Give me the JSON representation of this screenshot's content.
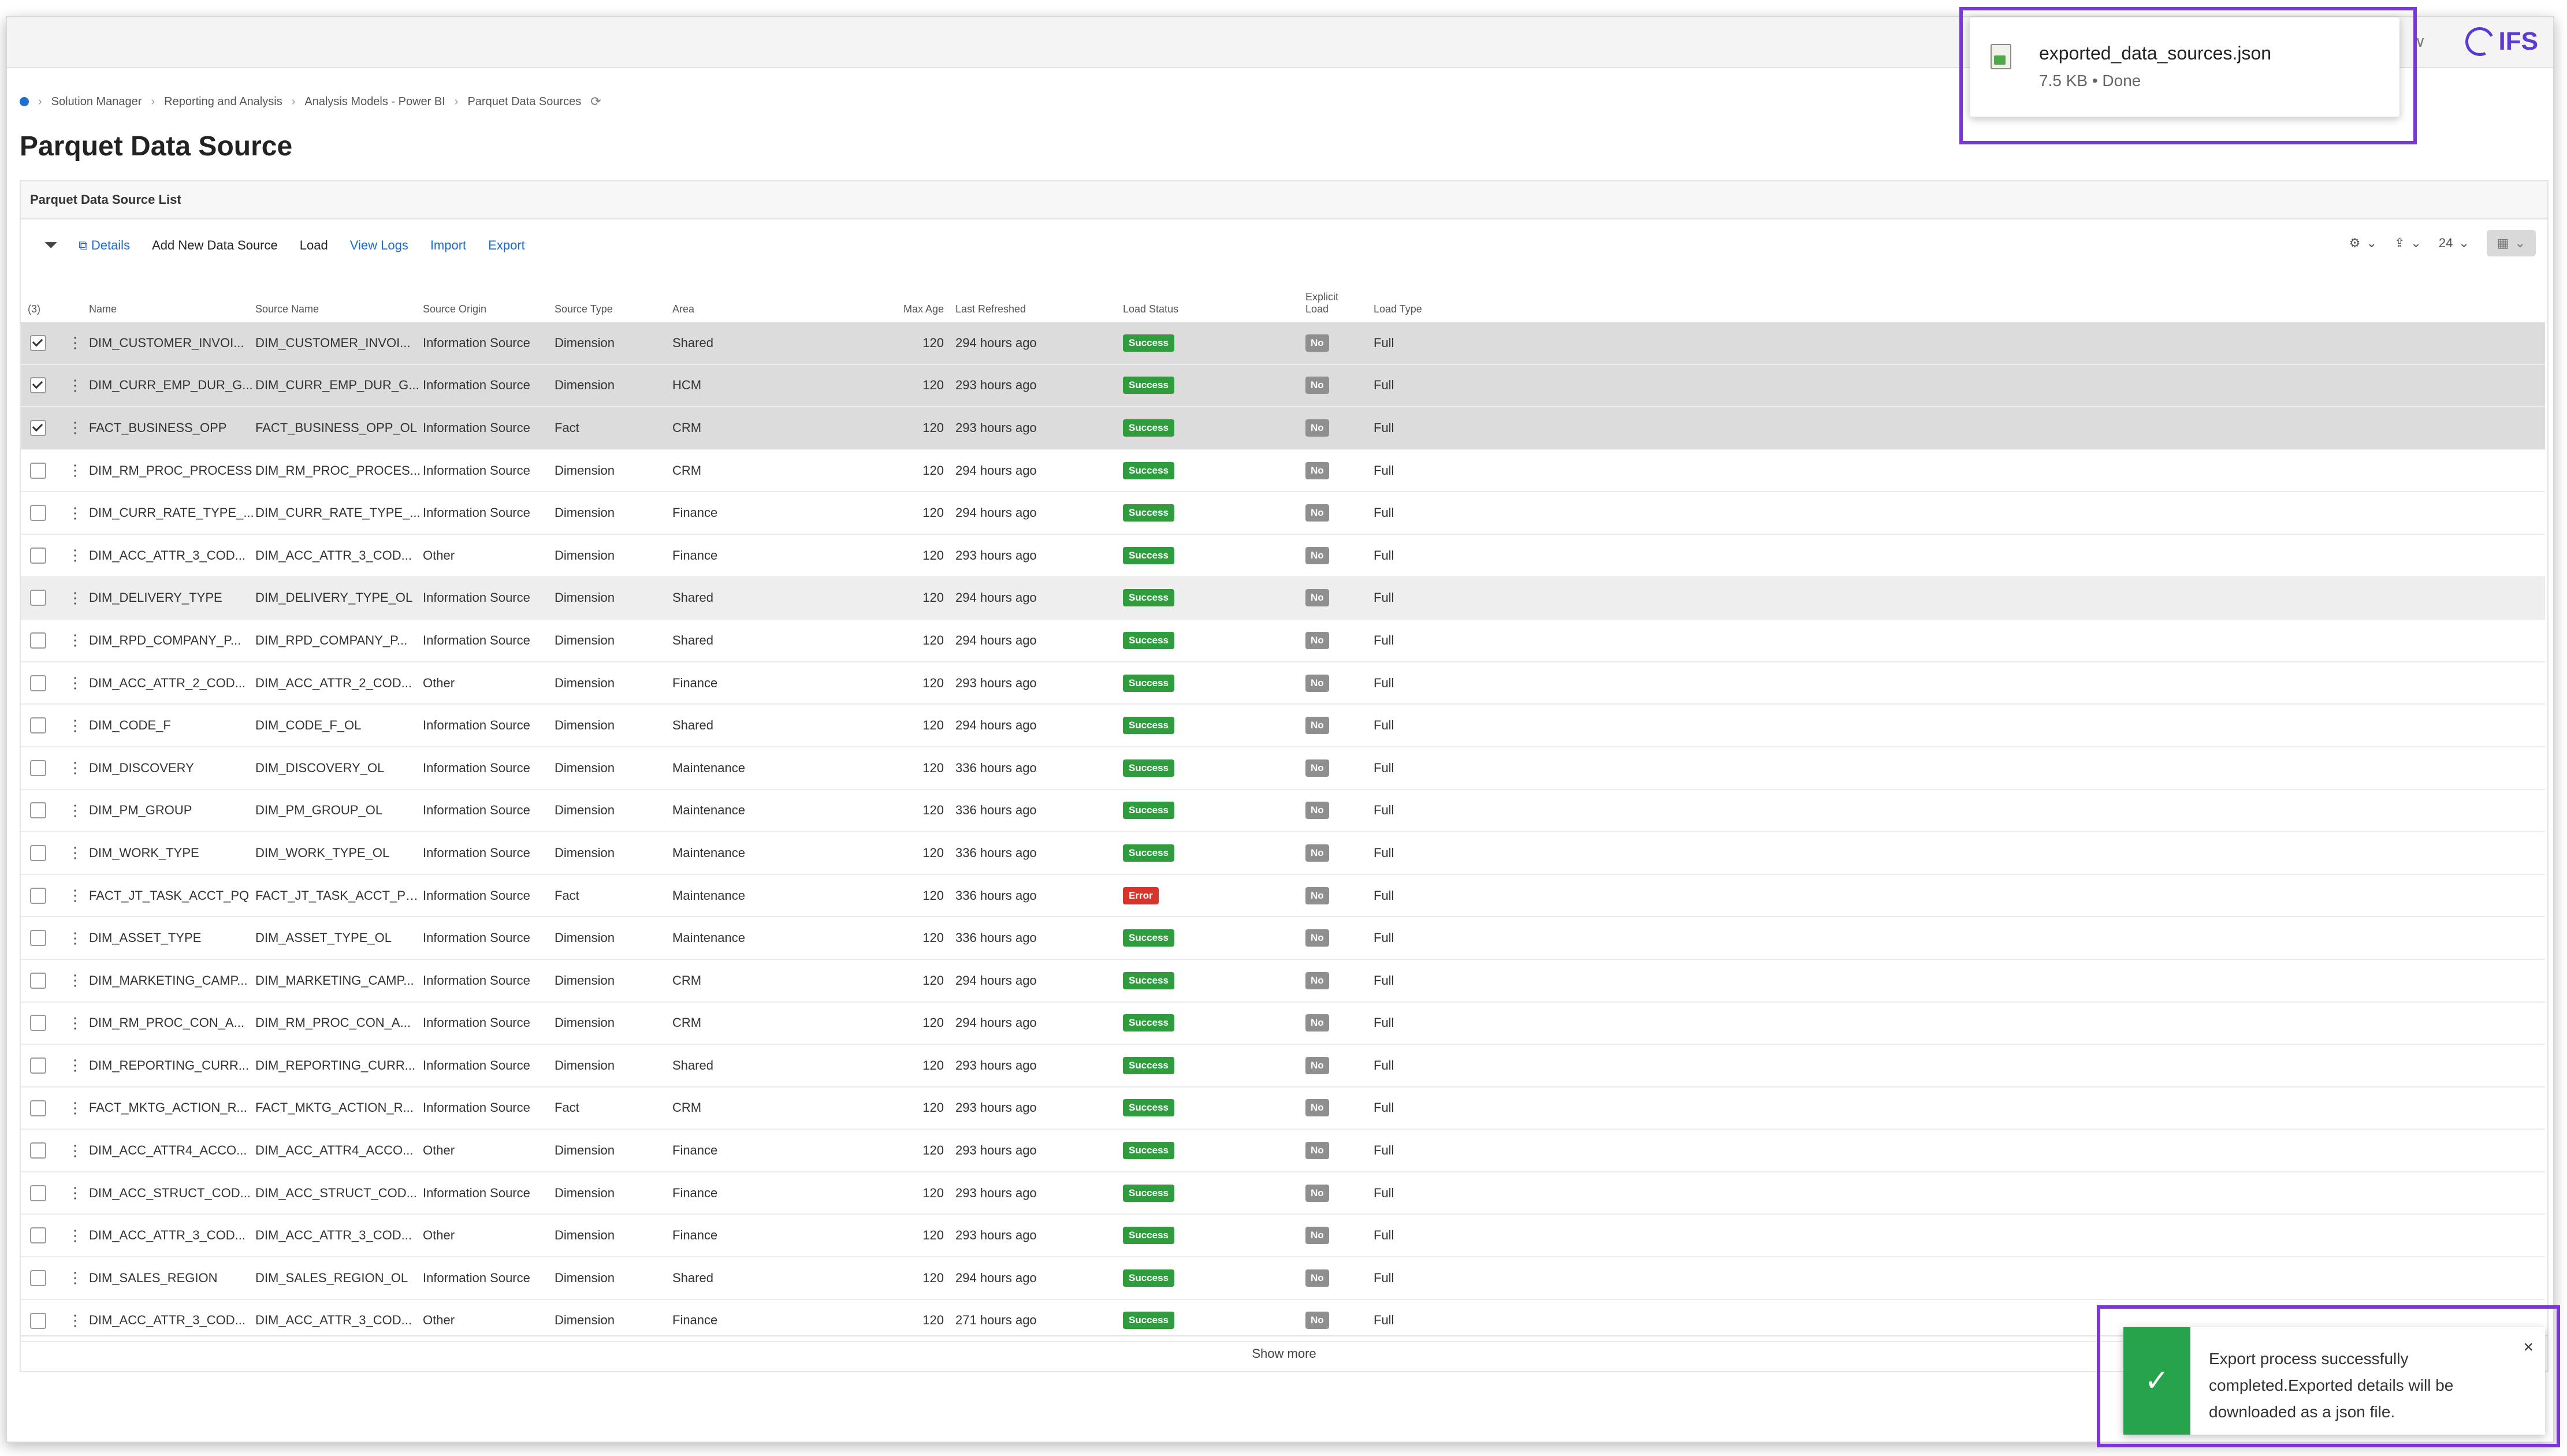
{
  "breadcrumb": [
    "Solution Manager",
    "Reporting and Analysis",
    "Analysis Models - Power BI",
    "Parquet Data Sources"
  ],
  "page_title": "Parquet Data Source",
  "list_title": "Parquet Data Source List",
  "brand": "IFS",
  "toolbar": {
    "details": "Details",
    "add": "Add New Data Source",
    "load": "Load",
    "view_logs": "View Logs",
    "import": "Import",
    "export": "Export",
    "page_size": "24"
  },
  "columns": {
    "selected_count": "(3)",
    "name": "Name",
    "source_name": "Source Name",
    "source_origin": "Source Origin",
    "source_type": "Source Type",
    "area": "Area",
    "max_age": "Max Age",
    "last_refreshed": "Last Refreshed",
    "load_status": "Load Status",
    "explicit_load_1": "Explicit",
    "explicit_load_2": "Load",
    "load_type": "Load Type"
  },
  "rows": [
    {
      "checked": true,
      "name": "DIM_CUSTOMER_INVOI...",
      "source": "DIM_CUSTOMER_INVOI...",
      "origin": "Information Source",
      "type": "Dimension",
      "area": "Shared",
      "max_age": "120",
      "refreshed": "294 hours ago",
      "status": "Success",
      "explicit": "No",
      "load_type": "Full"
    },
    {
      "checked": true,
      "name": "DIM_CURR_EMP_DUR_G...",
      "source": "DIM_CURR_EMP_DUR_G...",
      "origin": "Information Source",
      "type": "Dimension",
      "area": "HCM",
      "max_age": "120",
      "refreshed": "293 hours ago",
      "status": "Success",
      "explicit": "No",
      "load_type": "Full"
    },
    {
      "checked": true,
      "name": "FACT_BUSINESS_OPP",
      "source": "FACT_BUSINESS_OPP_OL",
      "origin": "Information Source",
      "type": "Fact",
      "area": "CRM",
      "max_age": "120",
      "refreshed": "293 hours ago",
      "status": "Success",
      "explicit": "No",
      "load_type": "Full"
    },
    {
      "checked": false,
      "name": "DIM_RM_PROC_PROCESS",
      "source": "DIM_RM_PROC_PROCES...",
      "origin": "Information Source",
      "type": "Dimension",
      "area": "CRM",
      "max_age": "120",
      "refreshed": "294 hours ago",
      "status": "Success",
      "explicit": "No",
      "load_type": "Full"
    },
    {
      "checked": false,
      "name": "DIM_CURR_RATE_TYPE_...",
      "source": "DIM_CURR_RATE_TYPE_...",
      "origin": "Information Source",
      "type": "Dimension",
      "area": "Finance",
      "max_age": "120",
      "refreshed": "294 hours ago",
      "status": "Success",
      "explicit": "No",
      "load_type": "Full"
    },
    {
      "checked": false,
      "name": "DIM_ACC_ATTR_3_COD...",
      "source": "DIM_ACC_ATTR_3_COD...",
      "origin": "Other",
      "type": "Dimension",
      "area": "Finance",
      "max_age": "120",
      "refreshed": "293 hours ago",
      "status": "Success",
      "explicit": "No",
      "load_type": "Full"
    },
    {
      "checked": false,
      "name": "DIM_DELIVERY_TYPE",
      "source": "DIM_DELIVERY_TYPE_OL",
      "origin": "Information Source",
      "type": "Dimension",
      "area": "Shared",
      "max_age": "120",
      "refreshed": "294 hours ago",
      "status": "Success",
      "explicit": "No",
      "load_type": "Full"
    },
    {
      "checked": false,
      "name": "DIM_RPD_COMPANY_P...",
      "source": "DIM_RPD_COMPANY_P...",
      "origin": "Information Source",
      "type": "Dimension",
      "area": "Shared",
      "max_age": "120",
      "refreshed": "294 hours ago",
      "status": "Success",
      "explicit": "No",
      "load_type": "Full"
    },
    {
      "checked": false,
      "name": "DIM_ACC_ATTR_2_COD...",
      "source": "DIM_ACC_ATTR_2_COD...",
      "origin": "Other",
      "type": "Dimension",
      "area": "Finance",
      "max_age": "120",
      "refreshed": "293 hours ago",
      "status": "Success",
      "explicit": "No",
      "load_type": "Full"
    },
    {
      "checked": false,
      "name": "DIM_CODE_F",
      "source": "DIM_CODE_F_OL",
      "origin": "Information Source",
      "type": "Dimension",
      "area": "Shared",
      "max_age": "120",
      "refreshed": "294 hours ago",
      "status": "Success",
      "explicit": "No",
      "load_type": "Full"
    },
    {
      "checked": false,
      "name": "DIM_DISCOVERY",
      "source": "DIM_DISCOVERY_OL",
      "origin": "Information Source",
      "type": "Dimension",
      "area": "Maintenance",
      "max_age": "120",
      "refreshed": "336 hours ago",
      "status": "Success",
      "explicit": "No",
      "load_type": "Full"
    },
    {
      "checked": false,
      "name": "DIM_PM_GROUP",
      "source": "DIM_PM_GROUP_OL",
      "origin": "Information Source",
      "type": "Dimension",
      "area": "Maintenance",
      "max_age": "120",
      "refreshed": "336 hours ago",
      "status": "Success",
      "explicit": "No",
      "load_type": "Full"
    },
    {
      "checked": false,
      "name": "DIM_WORK_TYPE",
      "source": "DIM_WORK_TYPE_OL",
      "origin": "Information Source",
      "type": "Dimension",
      "area": "Maintenance",
      "max_age": "120",
      "refreshed": "336 hours ago",
      "status": "Success",
      "explicit": "No",
      "load_type": "Full"
    },
    {
      "checked": false,
      "name": "FACT_JT_TASK_ACCT_PQ",
      "source": "FACT_JT_TASK_ACCT_PQ...",
      "origin": "Information Source",
      "type": "Fact",
      "area": "Maintenance",
      "max_age": "120",
      "refreshed": "336 hours ago",
      "status": "Error",
      "explicit": "No",
      "load_type": "Full"
    },
    {
      "checked": false,
      "name": "DIM_ASSET_TYPE",
      "source": "DIM_ASSET_TYPE_OL",
      "origin": "Information Source",
      "type": "Dimension",
      "area": "Maintenance",
      "max_age": "120",
      "refreshed": "336 hours ago",
      "status": "Success",
      "explicit": "No",
      "load_type": "Full"
    },
    {
      "checked": false,
      "name": "DIM_MARKETING_CAMP...",
      "source": "DIM_MARKETING_CAMP...",
      "origin": "Information Source",
      "type": "Dimension",
      "area": "CRM",
      "max_age": "120",
      "refreshed": "294 hours ago",
      "status": "Success",
      "explicit": "No",
      "load_type": "Full"
    },
    {
      "checked": false,
      "name": "DIM_RM_PROC_CON_A...",
      "source": "DIM_RM_PROC_CON_A...",
      "origin": "Information Source",
      "type": "Dimension",
      "area": "CRM",
      "max_age": "120",
      "refreshed": "294 hours ago",
      "status": "Success",
      "explicit": "No",
      "load_type": "Full"
    },
    {
      "checked": false,
      "name": "DIM_REPORTING_CURR...",
      "source": "DIM_REPORTING_CURR...",
      "origin": "Information Source",
      "type": "Dimension",
      "area": "Shared",
      "max_age": "120",
      "refreshed": "293 hours ago",
      "status": "Success",
      "explicit": "No",
      "load_type": "Full"
    },
    {
      "checked": false,
      "name": "FACT_MKTG_ACTION_R...",
      "source": "FACT_MKTG_ACTION_R...",
      "origin": "Information Source",
      "type": "Fact",
      "area": "CRM",
      "max_age": "120",
      "refreshed": "293 hours ago",
      "status": "Success",
      "explicit": "No",
      "load_type": "Full"
    },
    {
      "checked": false,
      "name": "DIM_ACC_ATTR4_ACCO...",
      "source": "DIM_ACC_ATTR4_ACCO...",
      "origin": "Other",
      "type": "Dimension",
      "area": "Finance",
      "max_age": "120",
      "refreshed": "293 hours ago",
      "status": "Success",
      "explicit": "No",
      "load_type": "Full"
    },
    {
      "checked": false,
      "name": "DIM_ACC_STRUCT_COD...",
      "source": "DIM_ACC_STRUCT_COD...",
      "origin": "Information Source",
      "type": "Dimension",
      "area": "Finance",
      "max_age": "120",
      "refreshed": "293 hours ago",
      "status": "Success",
      "explicit": "No",
      "load_type": "Full"
    },
    {
      "checked": false,
      "name": "DIM_ACC_ATTR_3_COD...",
      "source": "DIM_ACC_ATTR_3_COD...",
      "origin": "Other",
      "type": "Dimension",
      "area": "Finance",
      "max_age": "120",
      "refreshed": "293 hours ago",
      "status": "Success",
      "explicit": "No",
      "load_type": "Full"
    },
    {
      "checked": false,
      "name": "DIM_SALES_REGION",
      "source": "DIM_SALES_REGION_OL",
      "origin": "Information Source",
      "type": "Dimension",
      "area": "Shared",
      "max_age": "120",
      "refreshed": "294 hours ago",
      "status": "Success",
      "explicit": "No",
      "load_type": "Full"
    },
    {
      "checked": false,
      "name": "DIM_ACC_ATTR_3_COD...",
      "source": "DIM_ACC_ATTR_3_COD...",
      "origin": "Other",
      "type": "Dimension",
      "area": "Finance",
      "max_age": "120",
      "refreshed": "271 hours ago",
      "status": "Success",
      "explicit": "No",
      "load_type": "Full"
    }
  ],
  "show_more": "Show more",
  "download": {
    "filename": "exported_data_sources.json",
    "meta": "7.5 KB • Done"
  },
  "toast": {
    "message": "Export process successfully completed.Exported details will be downloaded as a json file.",
    "close": "×"
  },
  "colors": {
    "success": "#2f9d3e",
    "error": "#d9342b",
    "highlight": "#7b35d8",
    "link": "#1e6bc5"
  }
}
